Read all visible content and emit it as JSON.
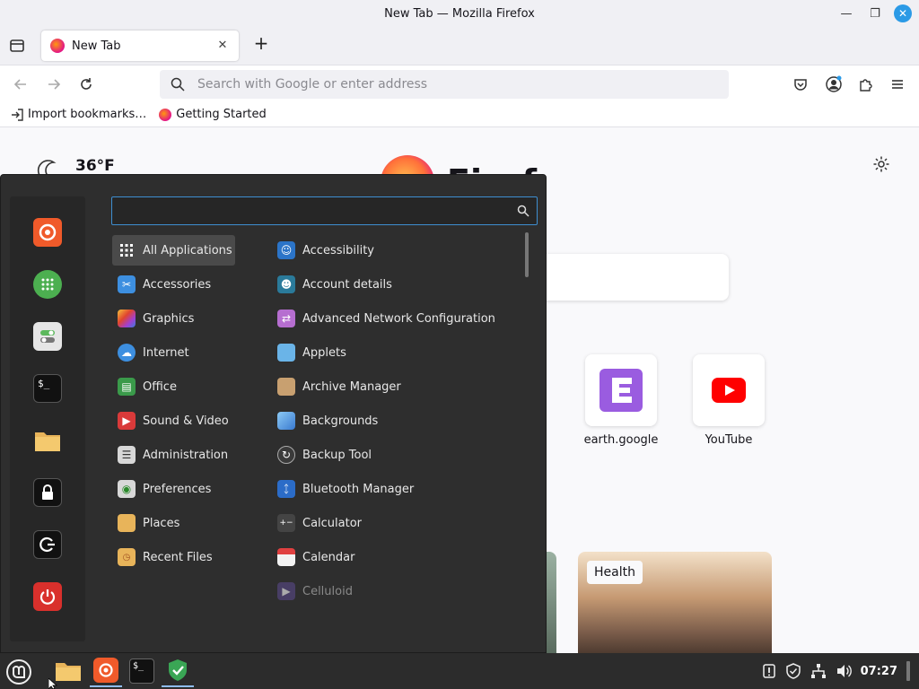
{
  "window": {
    "title": "New Tab — Mozilla Firefox"
  },
  "tabs": [
    {
      "label": "New Tab"
    }
  ],
  "navbar": {
    "url_placeholder": "Search with Google or enter address"
  },
  "bookmarks": [
    {
      "label": "Import bookmarks…"
    },
    {
      "label": "Getting Started"
    }
  ],
  "newtab": {
    "weather_temp": "36°F",
    "brand": "Firef",
    "shortcuts": [
      {
        "label": "earth.google"
      },
      {
        "label": "YouTube"
      }
    ],
    "story_tag": "Health"
  },
  "menu": {
    "search_placeholder": "",
    "categories": [
      {
        "label": "All Applications",
        "icon": "grid-icon",
        "color": "#4a4a4a"
      },
      {
        "label": "Accessories",
        "icon": "scissors-icon",
        "color": "#3d8fe0"
      },
      {
        "label": "Graphics",
        "icon": "graphics-icon",
        "color": "#c43fd0"
      },
      {
        "label": "Internet",
        "icon": "cloud-icon",
        "color": "#3d8fe0"
      },
      {
        "label": "Office",
        "icon": "office-icon",
        "color": "#3a9a4a"
      },
      {
        "label": "Sound & Video",
        "icon": "play-icon",
        "color": "#d93a3a"
      },
      {
        "label": "Administration",
        "icon": "admin-icon",
        "color": "#d8d8d8"
      },
      {
        "label": "Preferences",
        "icon": "toggle-icon",
        "color": "#d8d8d8"
      },
      {
        "label": "Places",
        "icon": "folder-icon",
        "color": "#e8b45a"
      },
      {
        "label": "Recent Files",
        "icon": "recent-folder-icon",
        "color": "#e8b45a"
      }
    ],
    "apps": [
      {
        "label": "Accessibility",
        "icon": "accessibility-icon",
        "color": "#2b74c8"
      },
      {
        "label": "Account details",
        "icon": "user-icon",
        "color": "#2a7a9a"
      },
      {
        "label": "Advanced Network Configuration",
        "icon": "network-icon",
        "color": "#b66ed0"
      },
      {
        "label": "Applets",
        "icon": "applets-icon",
        "color": "#6ab4e8"
      },
      {
        "label": "Archive Manager",
        "icon": "archive-icon",
        "color": "#c8a070"
      },
      {
        "label": "Backgrounds",
        "icon": "backgrounds-icon",
        "color": "#5aa0e0"
      },
      {
        "label": "Backup Tool",
        "icon": "backup-icon",
        "color": "#3a3a3a"
      },
      {
        "label": "Bluetooth Manager",
        "icon": "bluetooth-icon",
        "color": "#2b6cc8"
      },
      {
        "label": "Calculator",
        "icon": "calculator-icon",
        "color": "#444444"
      },
      {
        "label": "Calendar",
        "icon": "calendar-icon",
        "color": "#e04040"
      },
      {
        "label": "Celluloid",
        "icon": "celluloid-icon",
        "color": "#5a4a8a"
      }
    ]
  },
  "taskbar": {
    "clock": "07:27"
  }
}
